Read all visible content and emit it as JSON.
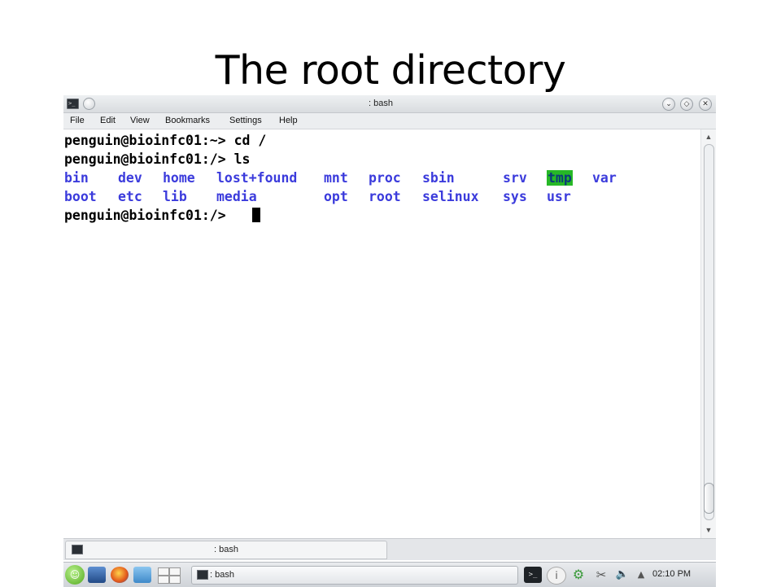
{
  "slide": {
    "title": "The root directory"
  },
  "window": {
    "title": ": bash",
    "app_icon": "terminal-icon",
    "buttons": [
      "minimize-button",
      "maximize-button",
      "close-button"
    ]
  },
  "menu": {
    "items": [
      "File",
      "Edit",
      "View",
      "Bookmarks",
      "Settings",
      "Help"
    ]
  },
  "terminal": {
    "lines": [
      "penguin@bioinfc01:~> cd /",
      "penguin@bioinfc01:/> ls"
    ],
    "listing_row1": [
      "bin",
      "dev",
      "home",
      "lost+found",
      "mnt",
      "proc",
      "sbin",
      "srv",
      "tmp",
      "var"
    ],
    "listing_row2": [
      "boot",
      "etc",
      "lib",
      "media",
      "opt",
      "root",
      "selinux",
      "sys",
      "usr"
    ],
    "prompt": "penguin@bioinfc01:/> ",
    "colors": {
      "directory": "#3b3bdc",
      "highlight_bg": "#26b826",
      "text": "#000000"
    }
  },
  "tabbar": {
    "tab_label": ": bash"
  },
  "panel": {
    "task_label": ": bash",
    "clock": "02:10 PM",
    "icons": [
      "opensuse-menu-icon",
      "desktop-icon",
      "firefox-icon",
      "file-manager-icon",
      "workspaces-icon",
      "terminal-tray-icon",
      "info-icon",
      "updater-icon",
      "scissors-icon",
      "volume-icon",
      "arrow-up-icon"
    ]
  }
}
